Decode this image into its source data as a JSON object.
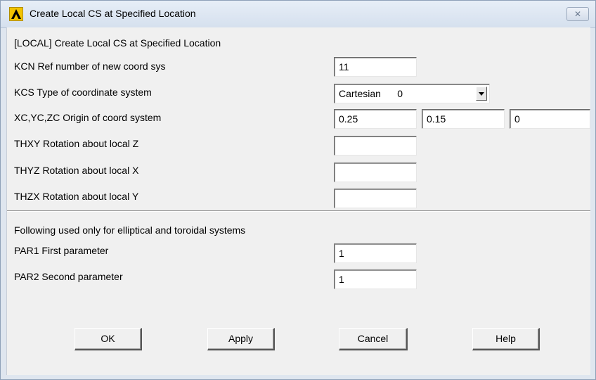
{
  "window": {
    "title": "Create Local CS at Specified Location",
    "close_glyph": "✕"
  },
  "dialog": {
    "header": "[LOCAL]  Create Local CS at Specified Location",
    "kcn": {
      "label": "KCN  Ref number of new coord sys",
      "value": "11"
    },
    "kcs": {
      "label": "KCS  Type of coordinate system",
      "value": "Cartesian      0"
    },
    "origin": {
      "label": "XC,YC,ZC  Origin of coord system",
      "xc": "0.25",
      "yc": "0.15",
      "zc": "0"
    },
    "thxy": {
      "label": "THXY  Rotation about local Z",
      "value": ""
    },
    "thyz": {
      "label": "THYZ  Rotation about local X",
      "value": ""
    },
    "thzx": {
      "label": "THZX  Rotation about local Y",
      "value": ""
    },
    "section_note": "Following used only for elliptical and toroidal systems",
    "par1": {
      "label": "PAR1  First parameter",
      "value": "1"
    },
    "par2": {
      "label": "PAR2  Second parameter",
      "value": "1"
    }
  },
  "buttons": {
    "ok": "OK",
    "apply": "Apply",
    "cancel": "Cancel",
    "help": "Help"
  }
}
